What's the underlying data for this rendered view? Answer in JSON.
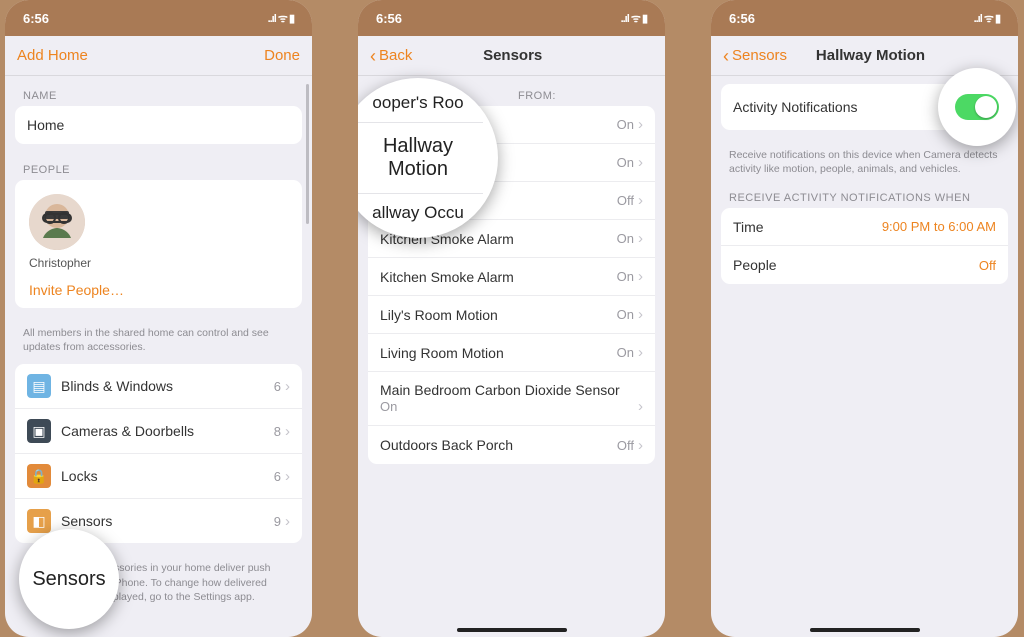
{
  "status": {
    "time": "6:56",
    "signal": "••••",
    "wifi": "⌃",
    "battery": "▮▮"
  },
  "screen1": {
    "nav": {
      "left": "Add Home",
      "right": "Done"
    },
    "name_section": "NAME",
    "home_name": "Home",
    "people_section": "PEOPLE",
    "person": "Christopher",
    "invite": "Invite People…",
    "people_footer": "All members in the shared home can control and see updates from accessories.",
    "categories": [
      {
        "label": "Blinds & Windows",
        "count": "6"
      },
      {
        "label": "Cameras & Doorbells",
        "count": "8"
      },
      {
        "label": "Locks",
        "count": "6"
      },
      {
        "label": "Sensors",
        "count": "9"
      }
    ],
    "bottom_footer": "Choose which accessories in your home deliver push notifications to this iPhone. To change how delivered notifications are displayed, go to the Settings app.",
    "callout": "Sensors"
  },
  "screen2": {
    "nav": {
      "back": "Back",
      "title": "Sensors"
    },
    "from_label": "FROM:",
    "sensors": [
      {
        "name": "Cooper's Room Motion",
        "state": "On"
      },
      {
        "name": "Hallway Motion",
        "state": "On"
      },
      {
        "name": "Hallway Occupancy",
        "state": "Off"
      },
      {
        "name": "Kitchen Smoke Alarm",
        "state": "On"
      },
      {
        "name": "Kitchen Smoke Alarm",
        "state": "On"
      },
      {
        "name": "Lily's Room Motion",
        "state": "On"
      },
      {
        "name": "Living Room Motion",
        "state": "On"
      },
      {
        "name": "Main Bedroom Carbon Dioxide Sensor",
        "state": "On"
      },
      {
        "name": "Outdoors Back Porch",
        "state": "Off"
      }
    ],
    "callout_top": "ooper's Roo",
    "callout_mid": "Hallway Motion",
    "callout_bot": "allway Occu"
  },
  "screen3": {
    "nav": {
      "back": "Sensors",
      "title": "Hallway Motion"
    },
    "activity_label": "Activity Notifications",
    "activity_footer": "Receive notifications on this device when Camera detects activity like motion, people, animals, and vehicles.",
    "when_label": "RECEIVE ACTIVITY NOTIFICATIONS WHEN",
    "rows": [
      {
        "label": "Time",
        "value": "9:00 PM to 6:00 AM"
      },
      {
        "label": "People",
        "value": "Off"
      }
    ]
  }
}
